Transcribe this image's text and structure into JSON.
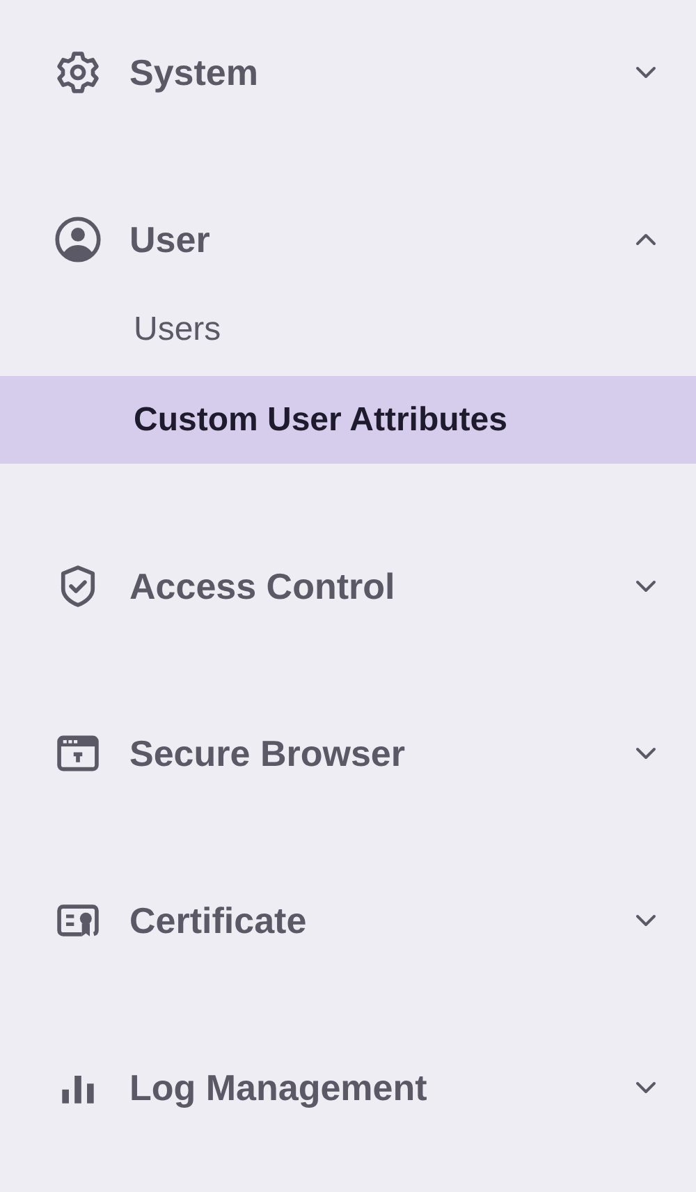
{
  "sidebar": {
    "groups": [
      {
        "label": "System",
        "expanded": false
      },
      {
        "label": "User",
        "expanded": true,
        "items": [
          {
            "label": "Users",
            "selected": false
          },
          {
            "label": "Custom User Attributes",
            "selected": true
          }
        ]
      },
      {
        "label": "Access Control",
        "expanded": false
      },
      {
        "label": "Secure Browser",
        "expanded": false
      },
      {
        "label": "Certificate",
        "expanded": false
      },
      {
        "label": "Log Management",
        "expanded": false
      }
    ]
  }
}
